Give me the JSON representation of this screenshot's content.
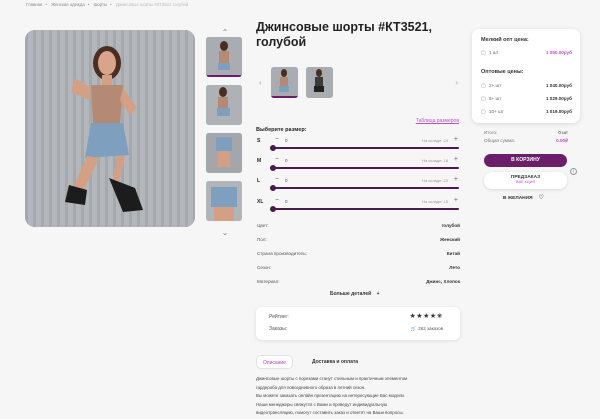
{
  "breadcrumbs": [
    "Главная",
    "Женская одежда",
    "Шорты",
    "Джинсовые шорты #КТ3521 голубой"
  ],
  "product": {
    "title": "Джинсовые шорты #КТ3521, голубой"
  },
  "sizes": {
    "heading": "Выберите размер:",
    "table_link": "Таблица размеров",
    "rows": [
      {
        "size": "S",
        "qty": "0",
        "stock": "На складе: 24"
      },
      {
        "size": "M",
        "qty": "0",
        "stock": "На складе: 18"
      },
      {
        "size": "L",
        "qty": "0",
        "stock": "На складе: 20"
      },
      {
        "size": "XL",
        "qty": "0",
        "stock": "На складе: 15"
      }
    ],
    "minus": "−",
    "plus": "+"
  },
  "specs": [
    {
      "k": "Цвет:",
      "v": "голубой"
    },
    {
      "k": "Пол:",
      "v": "Женский"
    },
    {
      "k": "Страна производитель:",
      "v": "Китай"
    },
    {
      "k": "Сезон:",
      "v": "Лето"
    },
    {
      "k": "Материал:",
      "v": "Джинс, Хлопок"
    }
  ],
  "more_details": "Больше деталей",
  "rating": {
    "label": "Рейтинг:",
    "stars": "★★★★✬",
    "value": 4.5,
    "orders_label": "Заказы:",
    "orders_count": "262 заказов"
  },
  "tabs": {
    "description": "Описание",
    "delivery": "Доставка и оплата"
  },
  "description_lines": [
    "Джинсовые шорты с порезами станут стильным и практичным элементом",
    "гардероба для повседневного образа в летний сезон.",
    "Вы можете заказать онлайн презентацию на интересующие Вас модели.",
    "Наши менеджеры свяжутся с Вами и проведут индивидуальную",
    "видеотрансляцию, помогут составить заказ и ответят на Ваши вопросы."
  ],
  "price_card": {
    "small_label": "Мелкий опт цена:",
    "small_qty": "1 шт",
    "small_price": "1 050.00руб",
    "wholesale_label": "Оптовые цены:",
    "wholesale": [
      {
        "qty": "2+ шт",
        "price": "1 040.00руб"
      },
      {
        "qty": "5+ шт",
        "price": "1 029.00руб"
      },
      {
        "qty": "10+ шт",
        "price": "1 019.00руб"
      }
    ]
  },
  "totals": {
    "total_label": "Итого:",
    "total_value": "0 шт",
    "sum_label": "Общая сумма:",
    "sum_value": "0.00₽"
  },
  "actions": {
    "cart": "В КОРЗИНУ",
    "preorder": "ПРЕДЗАКАЗ",
    "preorder_sub": "ВВЕ.КЦИЯ",
    "wish": "В ЖЕЛАНИЯ",
    "info": "i"
  },
  "icons": {
    "up": "chevron-up-icon",
    "down": "chevron-down-icon",
    "left": "chevron-left-icon",
    "right": "chevron-right-icon",
    "heart": "heart-icon",
    "plus": "plus-icon",
    "minus": "minus-icon"
  },
  "colors": {
    "accent": "#6b1e69",
    "pink": "#c24bc8"
  }
}
